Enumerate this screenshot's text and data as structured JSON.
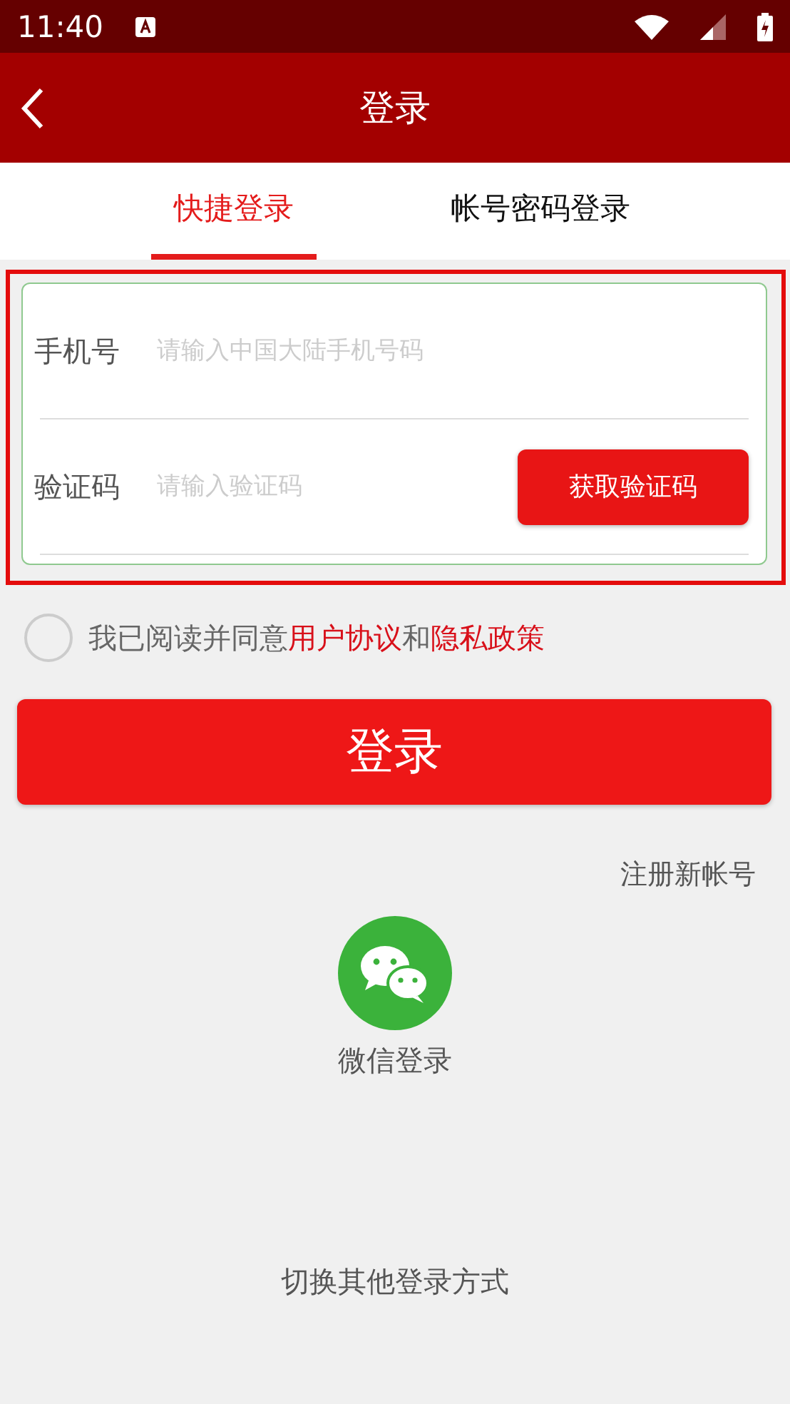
{
  "status_bar": {
    "time": "11:40"
  },
  "header": {
    "title": "登录"
  },
  "tabs": [
    {
      "label": "快捷登录",
      "selected": true
    },
    {
      "label": "帐号密码登录",
      "selected": false
    }
  ],
  "form": {
    "fields": [
      {
        "kind": "text",
        "label": "手机号",
        "placeholder": "请输入中国大陆手机号码"
      },
      {
        "kind": "code",
        "label": "验证码",
        "placeholder": "请输入验证码",
        "button": "获取验证码"
      }
    ]
  },
  "agreement": {
    "checked": false,
    "parts": [
      {
        "kind": "text",
        "text": "我已阅读并同意"
      },
      {
        "kind": "link",
        "text": "用户协议"
      },
      {
        "kind": "text",
        "text": "和"
      },
      {
        "kind": "link",
        "text": "隐私政策"
      }
    ]
  },
  "login_button": "登录",
  "register_link": "注册新帐号",
  "wechat": {
    "label": "微信登录"
  },
  "switch_link": "切换其他登录方式"
}
